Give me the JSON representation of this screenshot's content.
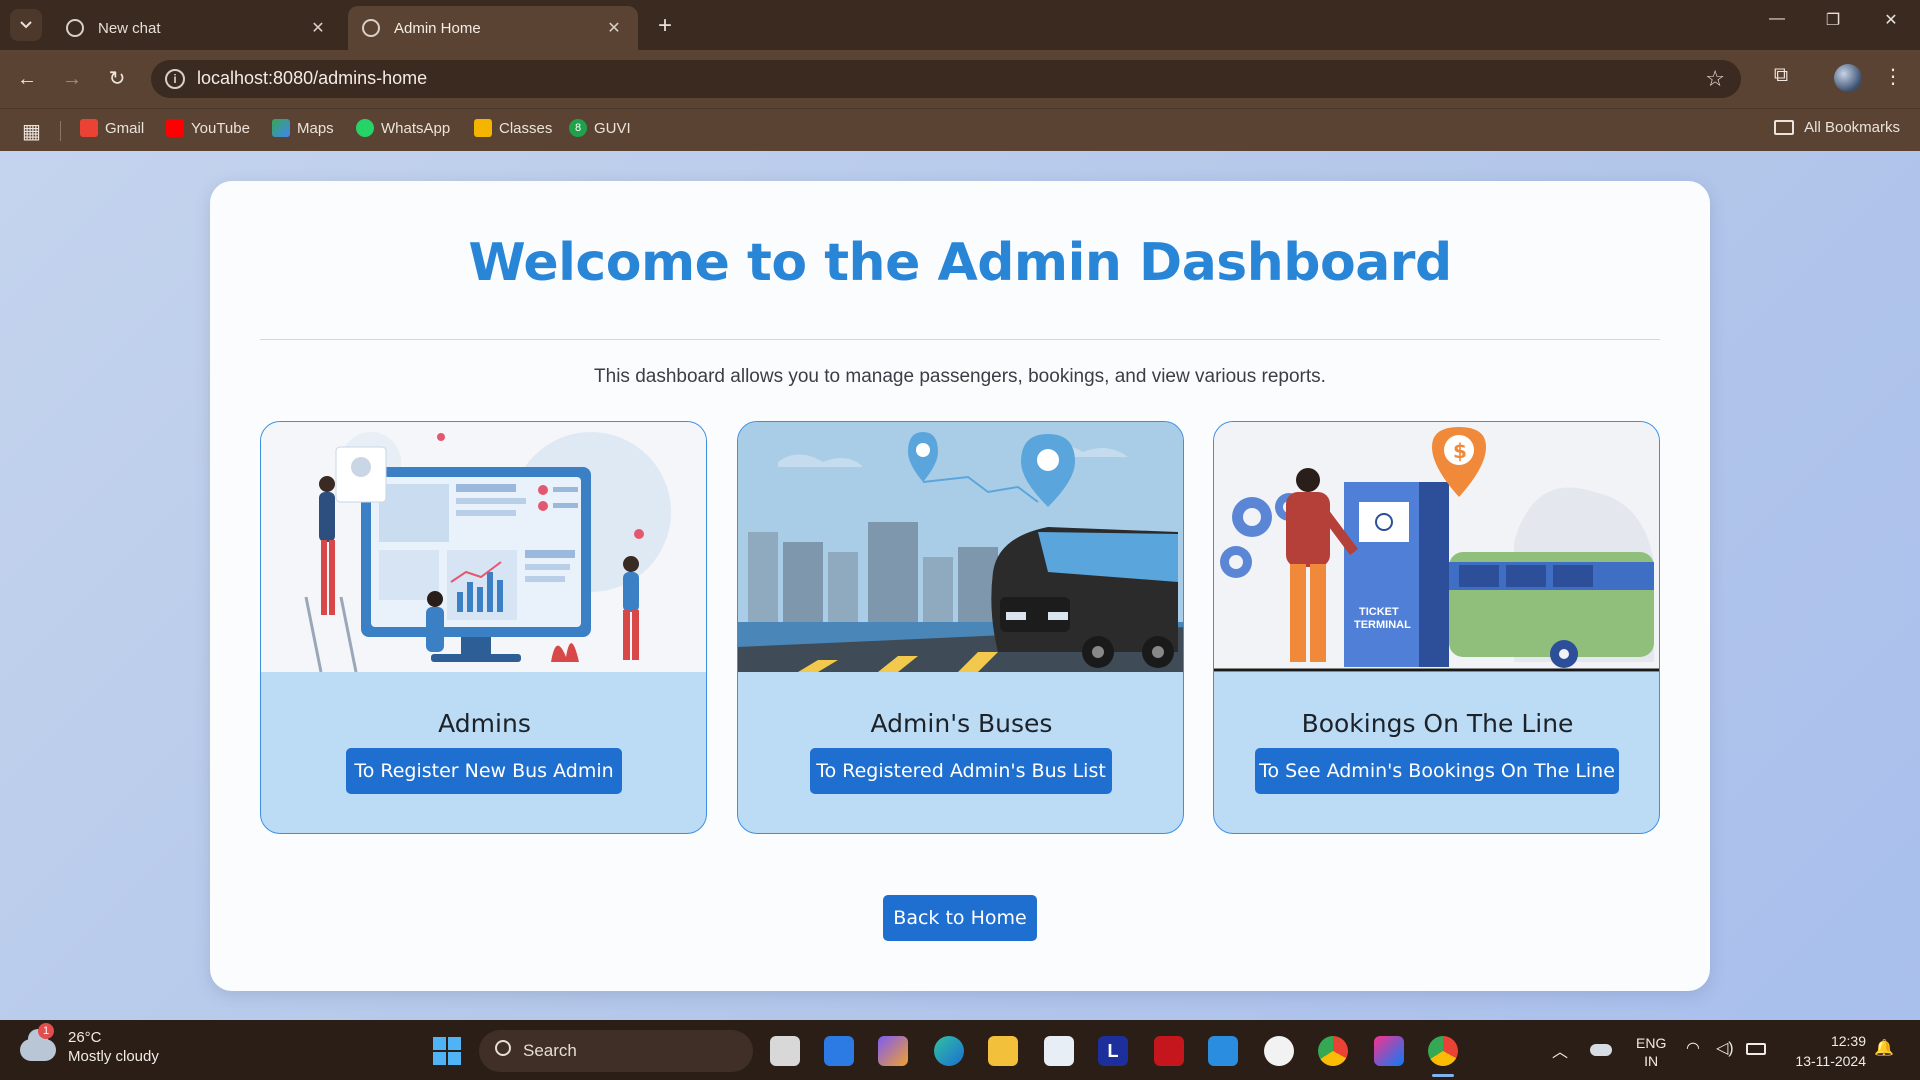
{
  "browser": {
    "tabs": [
      {
        "title": "New chat",
        "active": false
      },
      {
        "title": "Admin Home",
        "active": true
      }
    ],
    "url": "localhost:8080/admins-home",
    "bookmarks": [
      {
        "label": "Gmail",
        "color": "#ea4335"
      },
      {
        "label": "YouTube",
        "color": "#ff0000"
      },
      {
        "label": "Maps",
        "color": "#34a853"
      },
      {
        "label": "WhatsApp",
        "color": "#25d366"
      },
      {
        "label": "Classes",
        "color": "#f4b400"
      },
      {
        "label": "GUVI",
        "color": "#1fa24b"
      }
    ],
    "all_bookmarks_label": "All Bookmarks"
  },
  "page": {
    "heading": "Welcome to the Admin Dashboard",
    "description": "This dashboard allows you to manage passengers, bookings, and view various reports.",
    "cards": [
      {
        "title": "Admins",
        "button": "To Register New Bus Admin"
      },
      {
        "title": "Admin's Buses",
        "button": "To Registered Admin's Bus List"
      },
      {
        "title": "Bookings On The Line",
        "button": "To See Admin's Bookings On The Line"
      }
    ],
    "back_button": "Back to Home",
    "accent_color": "#2986d6",
    "button_color": "#1f6fd1"
  },
  "taskbar": {
    "weather_temp": "26°C",
    "weather_desc": "Mostly cloudy",
    "weather_badge": "1",
    "search_label": "Search",
    "lang_top": "ENG",
    "lang_bottom": "IN",
    "time": "12:39",
    "date": "13-11-2024",
    "ticket_terminal_line1": "TICKET",
    "ticket_terminal_line2": "TERMINAL",
    "app_l_letter": "L",
    "guvi_letter": "8"
  }
}
